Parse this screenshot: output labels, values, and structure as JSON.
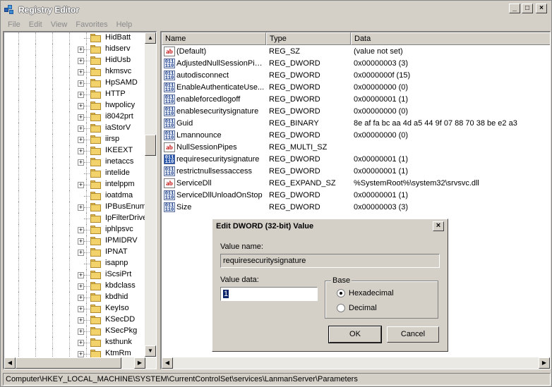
{
  "window": {
    "title": "Registry Editor",
    "min": "_",
    "max": "□",
    "close": "×"
  },
  "menu": [
    "File",
    "Edit",
    "View",
    "Favorites",
    "Help"
  ],
  "tree": {
    "items": [
      {
        "label": "HidBatt",
        "expandable": false
      },
      {
        "label": "hidserv",
        "expandable": true
      },
      {
        "label": "HidUsb",
        "expandable": true
      },
      {
        "label": "hkmsvc",
        "expandable": true
      },
      {
        "label": "HpSAMD",
        "expandable": true
      },
      {
        "label": "HTTP",
        "expandable": true
      },
      {
        "label": "hwpolicy",
        "expandable": true
      },
      {
        "label": "i8042prt",
        "expandable": true
      },
      {
        "label": "iaStorV",
        "expandable": true
      },
      {
        "label": "iirsp",
        "expandable": true
      },
      {
        "label": "IKEEXT",
        "expandable": true
      },
      {
        "label": "inetaccs",
        "expandable": true
      },
      {
        "label": "intelide",
        "expandable": false
      },
      {
        "label": "intelppm",
        "expandable": true
      },
      {
        "label": "ioatdma",
        "expandable": false
      },
      {
        "label": "IPBusEnum",
        "expandable": true
      },
      {
        "label": "IpFilterDriver",
        "expandable": false
      },
      {
        "label": "iphlpsvc",
        "expandable": true
      },
      {
        "label": "IPMIDRV",
        "expandable": true
      },
      {
        "label": "IPNAT",
        "expandable": true
      },
      {
        "label": "isapnp",
        "expandable": false
      },
      {
        "label": "iScsiPrt",
        "expandable": true
      },
      {
        "label": "kbdclass",
        "expandable": true
      },
      {
        "label": "kbdhid",
        "expandable": true
      },
      {
        "label": "KeyIso",
        "expandable": true
      },
      {
        "label": "KSecDD",
        "expandable": true
      },
      {
        "label": "KSecPkg",
        "expandable": true
      },
      {
        "label": "ksthunk",
        "expandable": true
      },
      {
        "label": "KtmRm",
        "expandable": true
      }
    ]
  },
  "list": {
    "columns": [
      "Name",
      "Type",
      "Data"
    ],
    "rows": [
      {
        "icon": "ab",
        "name": "(Default)",
        "type": "REG_SZ",
        "data": "(value not set)"
      },
      {
        "icon": "bin",
        "name": "AdjustedNullSessionPipes",
        "type": "REG_DWORD",
        "data": "0x00000003 (3)"
      },
      {
        "icon": "bin",
        "name": "autodisconnect",
        "type": "REG_DWORD",
        "data": "0x0000000f (15)"
      },
      {
        "icon": "bin",
        "name": "EnableAuthenticateUse...",
        "type": "REG_DWORD",
        "data": "0x00000000 (0)"
      },
      {
        "icon": "bin",
        "name": "enableforcedlogoff",
        "type": "REG_DWORD",
        "data": "0x00000001 (1)"
      },
      {
        "icon": "bin",
        "name": "enablesecuritysignature",
        "type": "REG_DWORD",
        "data": "0x00000000 (0)"
      },
      {
        "icon": "bin",
        "name": "Guid",
        "type": "REG_BINARY",
        "data": "8e af fa bc aa 4d a5 44 9f 07 88 70 38 be e2 a3"
      },
      {
        "icon": "bin",
        "name": "Lmannounce",
        "type": "REG_DWORD",
        "data": "0x00000000 (0)"
      },
      {
        "icon": "ab",
        "name": "NullSessionPipes",
        "type": "REG_MULTI_SZ",
        "data": ""
      },
      {
        "icon": "bin-sel",
        "name": "requiresecuritysignature",
        "type": "REG_DWORD",
        "data": "0x00000001 (1)"
      },
      {
        "icon": "bin",
        "name": "restrictnullsessaccess",
        "type": "REG_DWORD",
        "data": "0x00000001 (1)"
      },
      {
        "icon": "ab",
        "name": "ServiceDll",
        "type": "REG_EXPAND_SZ",
        "data": "%SystemRoot%\\system32\\srvsvc.dll"
      },
      {
        "icon": "bin",
        "name": "ServiceDllUnloadOnStop",
        "type": "REG_DWORD",
        "data": "0x00000001 (1)"
      },
      {
        "icon": "bin",
        "name": "Size",
        "type": "REG_DWORD",
        "data": "0x00000003 (3)"
      }
    ]
  },
  "status": {
    "path": "Computer\\HKEY_LOCAL_MACHINE\\SYSTEM\\CurrentControlSet\\services\\LanmanServer\\Parameters"
  },
  "dialog": {
    "title": "Edit DWORD (32-bit) Value",
    "value_name_label": "Value name:",
    "value_name": "requiresecuritysignature",
    "value_data_label": "Value data:",
    "value_data": "1",
    "base_label": "Base",
    "hex_label": "Hexadecimal",
    "dec_label": "Decimal",
    "ok_label": "OK",
    "cancel_label": "Cancel",
    "close_glyph": "×"
  }
}
